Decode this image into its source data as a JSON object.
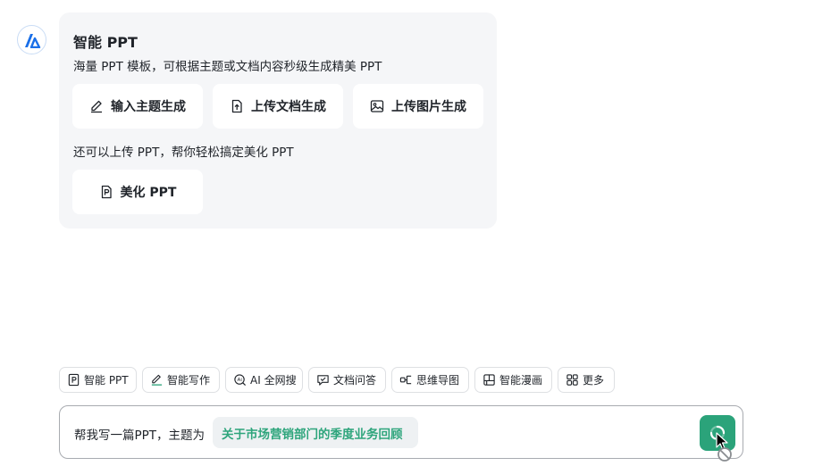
{
  "assistant": {
    "avatar_icon": "logo-icon"
  },
  "card": {
    "title": "智能 PPT",
    "description": "海量 PPT 模板，可根据主题或文档内容秒级生成精美 PPT",
    "options": [
      {
        "label": "输入主题生成",
        "icon": "pen-icon"
      },
      {
        "label": "上传文档生成",
        "icon": "upload-doc-icon"
      },
      {
        "label": "上传图片生成",
        "icon": "image-icon"
      }
    ],
    "secondary_description": "还可以上传 PPT，帮你轻松搞定美化 PPT",
    "beautify": {
      "label": "美化 PPT",
      "icon": "ppt-beautify-icon"
    }
  },
  "toolbar": {
    "items": [
      {
        "label": "智能 PPT",
        "icon": "ppt-icon"
      },
      {
        "label": "智能写作",
        "icon": "write-icon"
      },
      {
        "label": "AI 全网搜",
        "icon": "ai-search-icon"
      },
      {
        "label": "文档问答",
        "icon": "doc-qa-icon"
      },
      {
        "label": "思维导图",
        "icon": "mindmap-icon"
      },
      {
        "label": "智能漫画",
        "icon": "comic-icon"
      },
      {
        "label": "更多",
        "icon": "grid-icon"
      }
    ]
  },
  "input": {
    "prefix": "帮我写一篇PPT，主题为",
    "topic": "关于市场营销部门的季度业务回顾"
  },
  "colors": {
    "accent": "#2ba37a",
    "topic_text": "#2ea57c",
    "logo": "#1a6fe8"
  }
}
